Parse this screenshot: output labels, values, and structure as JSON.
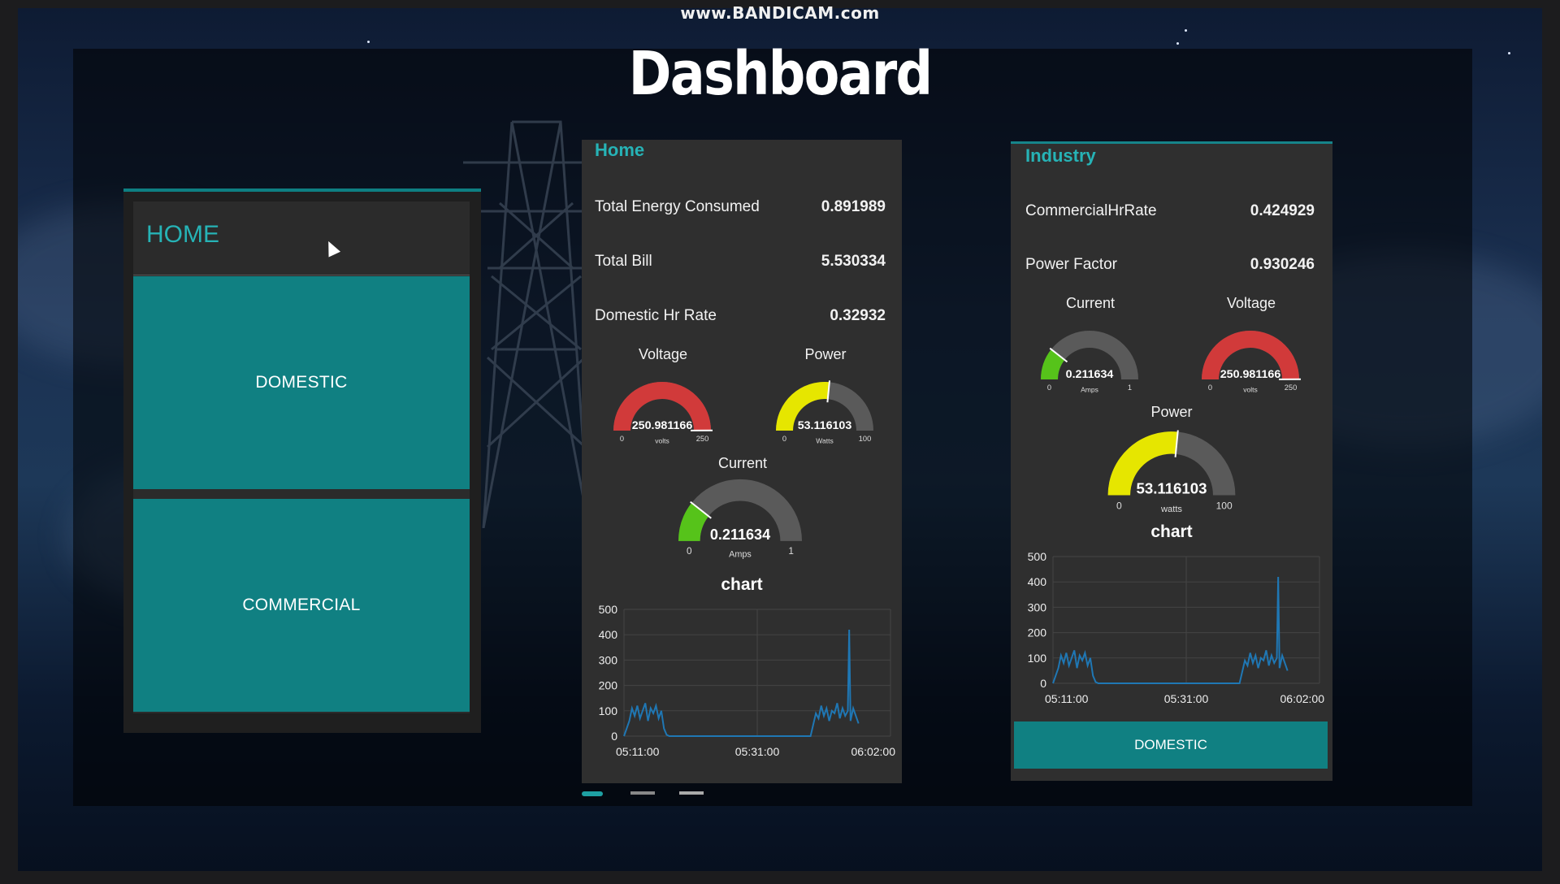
{
  "watermark": "www.BANDICAM.com",
  "page_title": "Dashboard",
  "nav_panel": {
    "header": "HOME",
    "buttons": [
      "DOMESTIC",
      "COMMERCIAL"
    ]
  },
  "home_panel": {
    "title": "Home",
    "rows": [
      {
        "label": "Total Energy Consumed",
        "value": "0.891989"
      },
      {
        "label": "Total Bill",
        "value": "5.530334"
      },
      {
        "label": "Domestic Hr Rate",
        "value": "0.32932"
      }
    ],
    "gauges": {
      "voltage": {
        "title": "Voltage",
        "value": "250.981166",
        "unit": "volts",
        "min": "0",
        "max": "250",
        "fraction": 1.0,
        "color": "#d13a3a"
      },
      "power": {
        "title": "Power",
        "value": "53.116103",
        "unit": "Watts",
        "min": "0",
        "max": "100",
        "fraction": 0.531,
        "color": "#e6e600"
      },
      "current": {
        "title": "Current",
        "value": "0.211634",
        "unit": "Amps",
        "min": "0",
        "max": "1",
        "fraction": 0.212,
        "color": "#56c31a"
      }
    },
    "chart_title": "chart"
  },
  "industry_panel": {
    "title": "Industry",
    "rows": [
      {
        "label": "CommercialHrRate",
        "value": "0.424929"
      },
      {
        "label": "Power Factor",
        "value": "0.930246"
      }
    ],
    "gauges": {
      "current": {
        "title": "Current",
        "value": "0.211634",
        "unit": "Amps",
        "min": "0",
        "max": "1",
        "fraction": 0.212,
        "color": "#56c31a"
      },
      "voltage": {
        "title": "Voltage",
        "value": "250.981166",
        "unit": "volts",
        "min": "0",
        "max": "250",
        "fraction": 1.0,
        "color": "#d13a3a"
      },
      "power": {
        "title": "Power",
        "value": "53.116103",
        "unit": "watts",
        "min": "0",
        "max": "100",
        "fraction": 0.531,
        "color": "#e6e600"
      }
    },
    "chart_title": "chart",
    "footer_button": "DOMESTIC"
  },
  "chart_data": [
    {
      "type": "line",
      "title": "chart",
      "ylim": [
        0,
        500
      ],
      "y_ticks": [
        "500",
        "400",
        "300",
        "200",
        "100",
        "0"
      ],
      "x_ticks": [
        "05:11:00",
        "05:31:00",
        "06:02:00"
      ],
      "x": [
        0,
        0.02,
        0.03,
        0.04,
        0.05,
        0.06,
        0.07,
        0.08,
        0.09,
        0.1,
        0.11,
        0.12,
        0.13,
        0.14,
        0.15,
        0.16,
        0.17,
        0.3,
        0.5,
        0.7,
        0.72,
        0.73,
        0.74,
        0.75,
        0.76,
        0.77,
        0.78,
        0.79,
        0.8,
        0.81,
        0.82,
        0.83,
        0.84,
        0.845,
        0.85,
        0.86,
        0.87,
        0.88
      ],
      "series": [
        {
          "values": [
            0,
            60,
            110,
            80,
            120,
            70,
            100,
            130,
            60,
            110,
            90,
            120,
            70,
            100,
            30,
            5,
            0,
            0,
            0,
            0,
            90,
            70,
            120,
            80,
            110,
            60,
            100,
            90,
            130,
            70,
            110,
            80,
            100,
            420,
            60,
            110,
            80,
            50
          ]
        }
      ],
      "color": "#1f77b4"
    },
    {
      "type": "line",
      "title": "chart",
      "ylim": [
        0,
        500
      ],
      "y_ticks": [
        "500",
        "400",
        "300",
        "200",
        "100",
        "0"
      ],
      "x_ticks": [
        "05:11:00",
        "05:31:00",
        "06:02:00"
      ],
      "x": [
        0,
        0.02,
        0.03,
        0.04,
        0.05,
        0.06,
        0.07,
        0.08,
        0.09,
        0.1,
        0.11,
        0.12,
        0.13,
        0.14,
        0.15,
        0.16,
        0.17,
        0.3,
        0.5,
        0.7,
        0.72,
        0.73,
        0.74,
        0.75,
        0.76,
        0.77,
        0.78,
        0.79,
        0.8,
        0.81,
        0.82,
        0.83,
        0.84,
        0.845,
        0.85,
        0.86,
        0.87,
        0.88
      ],
      "series": [
        {
          "values": [
            0,
            60,
            110,
            80,
            120,
            70,
            100,
            130,
            60,
            110,
            90,
            120,
            70,
            100,
            30,
            5,
            0,
            0,
            0,
            0,
            90,
            70,
            120,
            80,
            110,
            60,
            100,
            90,
            130,
            70,
            110,
            80,
            100,
            420,
            60,
            110,
            80,
            50
          ]
        }
      ],
      "color": "#1f77b4"
    }
  ]
}
